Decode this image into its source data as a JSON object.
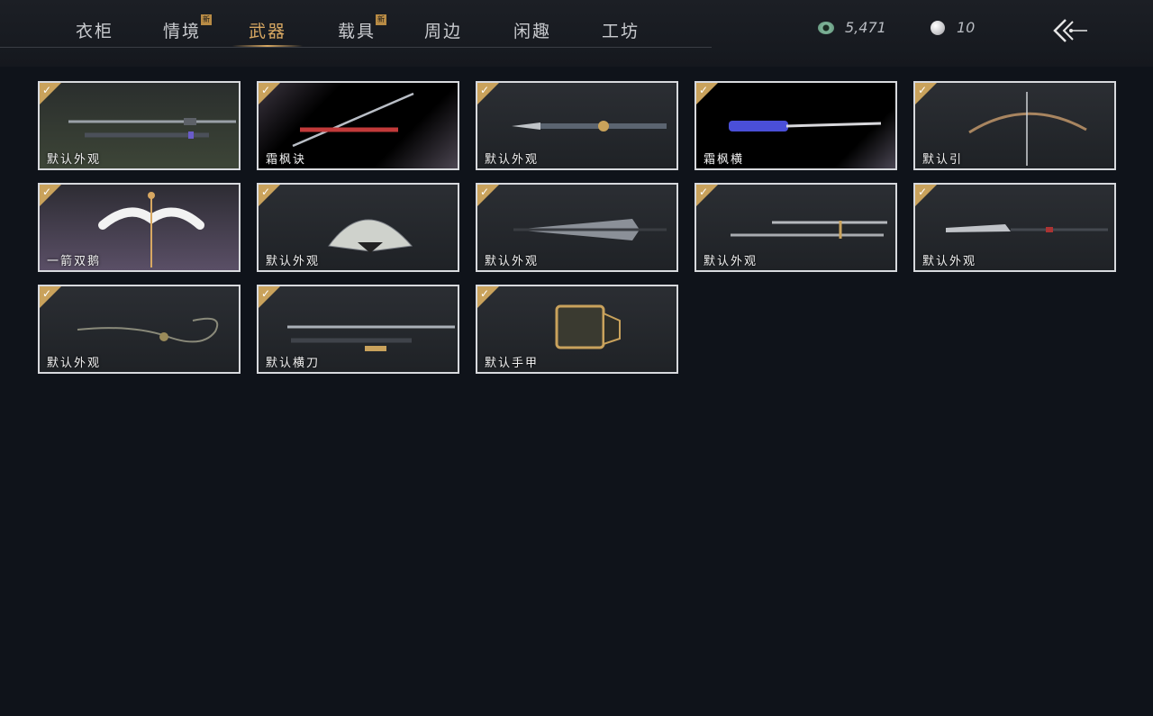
{
  "tabs": [
    {
      "label": "衣柜",
      "new": false,
      "active": false
    },
    {
      "label": "情境",
      "new": true,
      "active": false
    },
    {
      "label": "武器",
      "new": false,
      "active": true
    },
    {
      "label": "载具",
      "new": true,
      "active": false
    },
    {
      "label": "周边",
      "new": false,
      "active": false
    },
    {
      "label": "闲趣",
      "new": false,
      "active": false
    },
    {
      "label": "工坊",
      "new": false,
      "active": false
    }
  ],
  "new_badge": "新",
  "currency": {
    "coins": "5,471",
    "pearls": "10",
    "coin_icon": "jade-coin-icon",
    "pearl_icon": "pearl-icon"
  },
  "check_glyph": "✓",
  "items": [
    {
      "label": "默认外观",
      "icon": "sword-pair-icon"
    },
    {
      "label": "霜枫诀",
      "icon": "sword-red-icon"
    },
    {
      "label": "默认外观",
      "icon": "spear-gold-icon"
    },
    {
      "label": "霜枫横",
      "icon": "spear-blue-icon"
    },
    {
      "label": "默认引",
      "icon": "bow-icon"
    },
    {
      "label": "一箭双鹅",
      "icon": "swan-bow-icon"
    },
    {
      "label": "默认外观",
      "icon": "fan-icon"
    },
    {
      "label": "默认外观",
      "icon": "umbrella-icon"
    },
    {
      "label": "默认外观",
      "icon": "dual-blades-icon"
    },
    {
      "label": "默认外观",
      "icon": "glaive-icon"
    },
    {
      "label": "默认外观",
      "icon": "rope-dart-icon"
    },
    {
      "label": "默认横刀",
      "icon": "saber-icon"
    },
    {
      "label": "默认手甲",
      "icon": "gauntlet-icon"
    }
  ],
  "colors": {
    "accent": "#d8a862",
    "badge": "#b88b45",
    "check": "#c9a25c",
    "background": "#0f131a"
  }
}
